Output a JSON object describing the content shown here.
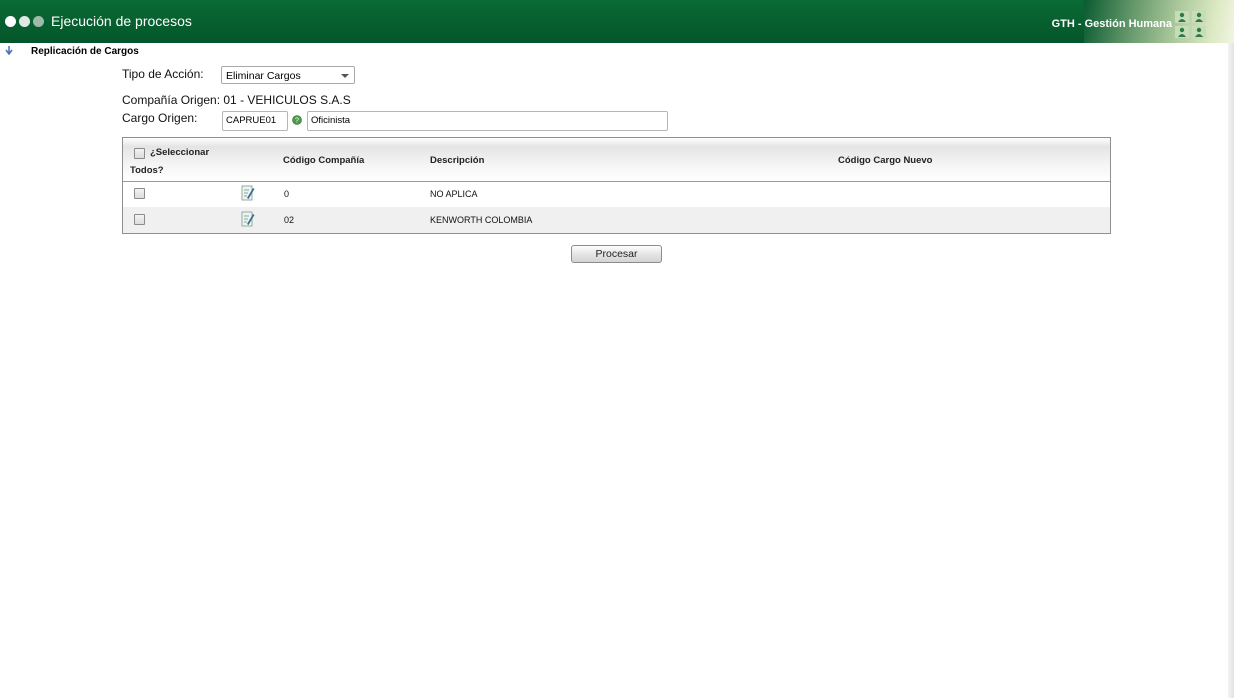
{
  "header": {
    "title": "Ejecución de procesos",
    "brand": "GTH - Gestión Humana"
  },
  "section": {
    "title": "Replicación de Cargos"
  },
  "form": {
    "tipo_accion_label": "Tipo de Acción:",
    "tipo_accion_value": "Eliminar Cargos",
    "compania_label": "Compañía Origen: 01 - VEHICULOS S.A.S",
    "cargo_label": "Cargo Origen:",
    "cargo_code": "CAPRUE01",
    "cargo_name": "Oficinista"
  },
  "table": {
    "select_all_line1": "¿Seleccionar",
    "select_all_line2": "Todos?",
    "headers": {
      "codigo_compania": "Código Compañía",
      "descripcion": "Descripción",
      "codigo_cargo_nuevo": "Código Cargo Nuevo"
    },
    "rows": [
      {
        "codigo": "0",
        "descripcion": "NO APLICA",
        "cargo_nuevo": ""
      },
      {
        "codigo": "02",
        "descripcion": "KENWORTH COLOMBIA",
        "cargo_nuevo": ""
      }
    ]
  },
  "actions": {
    "procesar": "Procesar"
  },
  "icons": {
    "section": "collapse-arrow-icon",
    "help": "help-icon",
    "edit": "edit-note-icon",
    "brand": "people-icon"
  },
  "colors": {
    "header_green": "#04562a",
    "accent": "#0a6a35"
  }
}
